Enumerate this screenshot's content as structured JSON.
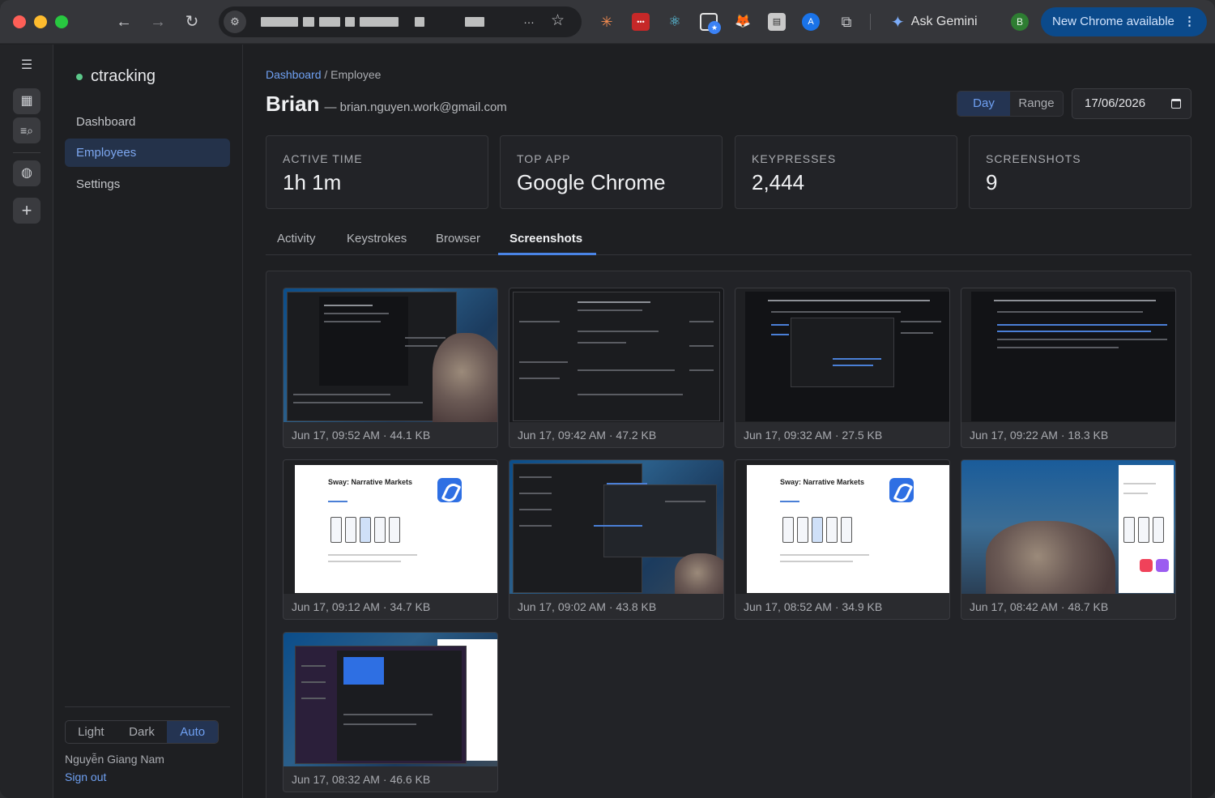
{
  "browser": {
    "ask_gemini": "Ask Gemini",
    "profile_initial": "B",
    "update_label": "New Chrome available",
    "url_ellipsis": "…"
  },
  "app": {
    "brand": "ctracking",
    "nav": [
      "Dashboard",
      "Employees",
      "Settings"
    ],
    "theme_options": [
      "Light",
      "Dark",
      "Auto"
    ],
    "user_name": "Nguyễn Giang Nam",
    "sign_out": "Sign out"
  },
  "page": {
    "breadcrumb_link": "Dashboard",
    "breadcrumb_current": " / Employee",
    "employee_name": "Brian",
    "employee_email": "— brian.nguyen.work@gmail.com",
    "mode_options": [
      "Day",
      "Range"
    ],
    "date": "17/06/2026"
  },
  "stats": [
    {
      "label": "ACTIVE TIME",
      "value": "1h 1m"
    },
    {
      "label": "TOP APP",
      "value": "Google Chrome"
    },
    {
      "label": "KEYPRESSES",
      "value": "2,444"
    },
    {
      "label": "SCREENSHOTS",
      "value": "9"
    }
  ],
  "tabs": [
    "Activity",
    "Keystrokes",
    "Browser",
    "Screenshots"
  ],
  "screenshots": [
    {
      "caption": "Jun 17, 09:52 AM · 44.1 KB"
    },
    {
      "caption": "Jun 17, 09:42 AM · 47.2 KB"
    },
    {
      "caption": "Jun 17, 09:32 AM · 27.5 KB"
    },
    {
      "caption": "Jun 17, 09:22 AM · 18.3 KB"
    },
    {
      "caption": "Jun 17, 09:12 AM · 34.7 KB",
      "thumb_title": "Sway: Narrative Markets"
    },
    {
      "caption": "Jun 17, 09:02 AM · 43.8 KB"
    },
    {
      "caption": "Jun 17, 08:52 AM · 34.9 KB",
      "thumb_title": "Sway: Narrative Markets"
    },
    {
      "caption": "Jun 17, 08:42 AM · 48.7 KB"
    },
    {
      "caption": "Jun 17, 08:32 AM · 46.6 KB"
    }
  ],
  "colors": {
    "accent": "#6fa0f2",
    "active_nav_bg": "#24324a",
    "status_dot": "#5cc88a",
    "update_pill": "#0b4a8b"
  },
  "icons": {
    "rail": [
      "collapse-menu-icon",
      "grid-icon",
      "search-list-icon",
      "globe-icon",
      "plus-icon"
    ],
    "browser": [
      "back-arrow-icon",
      "forward-arrow-icon",
      "reload-icon",
      "site-settings-icon",
      "star-icon",
      "extensions-icon",
      "gemini-sparkle-icon",
      "more-vert-icon"
    ]
  }
}
